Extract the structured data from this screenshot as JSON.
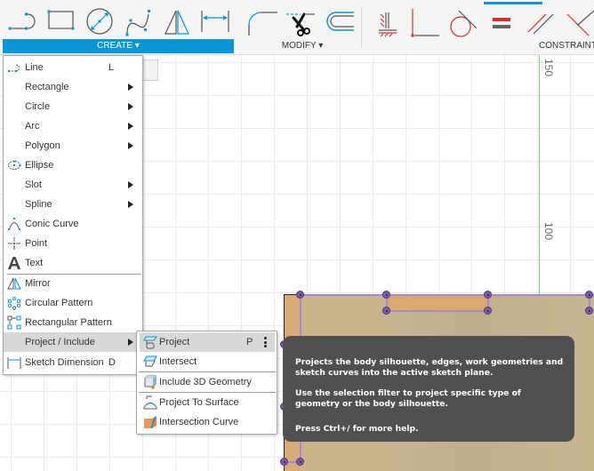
{
  "toolbar": {
    "groups": {
      "create": "CREATE",
      "modify": "MODIFY",
      "constraints": "CONSTRAINTS"
    },
    "create_tools": [
      "line",
      "rectangle",
      "circle",
      "spline",
      "mirror",
      "sketch-dimension"
    ],
    "modify_tools": [
      "fillet",
      "trim",
      "offset"
    ],
    "constraint_tools": [
      "fix",
      "coincident",
      "tangent",
      "equal",
      "parallel",
      "perpendicular"
    ],
    "accent_color": "#0696d7"
  },
  "canvas": {
    "ruler_labels": [
      "150",
      "100"
    ],
    "axis_color": "#7ed67e",
    "sketch_color": "#a48ad6"
  },
  "create_menu": {
    "items": [
      {
        "label": "Line",
        "shortcut": "L",
        "icon": "line-icon",
        "submenu": false
      },
      {
        "label": "Rectangle",
        "shortcut": "",
        "icon": "",
        "submenu": true
      },
      {
        "label": "Circle",
        "shortcut": "",
        "icon": "",
        "submenu": true
      },
      {
        "label": "Arc",
        "shortcut": "",
        "icon": "",
        "submenu": true
      },
      {
        "label": "Polygon",
        "shortcut": "",
        "icon": "",
        "submenu": true
      },
      {
        "label": "Ellipse",
        "shortcut": "",
        "icon": "ellipse-icon",
        "submenu": false
      },
      {
        "label": "Slot",
        "shortcut": "",
        "icon": "",
        "submenu": true
      },
      {
        "label": "Spline",
        "shortcut": "",
        "icon": "",
        "submenu": true
      },
      {
        "label": "Conic Curve",
        "shortcut": "",
        "icon": "conic-curve-icon",
        "submenu": false
      },
      {
        "label": "Point",
        "shortcut": "",
        "icon": "point-icon",
        "submenu": false
      },
      {
        "label": "Text",
        "shortcut": "",
        "icon": "text-icon",
        "submenu": false
      },
      {
        "label": "Mirror",
        "shortcut": "",
        "icon": "mirror-icon",
        "submenu": false
      },
      {
        "label": "Circular Pattern",
        "shortcut": "",
        "icon": "circular-pattern-icon",
        "submenu": false
      },
      {
        "label": "Rectangular Pattern",
        "shortcut": "",
        "icon": "rectangular-pattern-icon",
        "submenu": false
      },
      {
        "label": "Project / Include",
        "shortcut": "",
        "icon": "",
        "submenu": true,
        "highlighted": true
      },
      {
        "label": "Sketch Dimension",
        "shortcut": "D",
        "icon": "sketch-dimension-icon",
        "submenu": false
      }
    ]
  },
  "project_submenu": {
    "items": [
      {
        "label": "Project",
        "shortcut": "P",
        "icon": "project-icon",
        "highlighted": true
      },
      {
        "label": "Intersect",
        "shortcut": "",
        "icon": "intersect-icon"
      },
      {
        "label": "Include 3D Geometry",
        "shortcut": "",
        "icon": "include-3d-geometry-icon"
      },
      {
        "label": "Project To Surface",
        "shortcut": "",
        "icon": "project-to-surface-icon"
      },
      {
        "label": "Intersection Curve",
        "shortcut": "",
        "icon": "intersection-curve-icon"
      }
    ]
  },
  "tooltip": {
    "paragraph1": "Projects the body silhouette, edges, work geometries and sketch curves into the active sketch plane.",
    "paragraph2": "Use the selection filter to project specific type of geometry or the body silhouette.",
    "paragraph3": "Press Ctrl+/ for more help."
  }
}
